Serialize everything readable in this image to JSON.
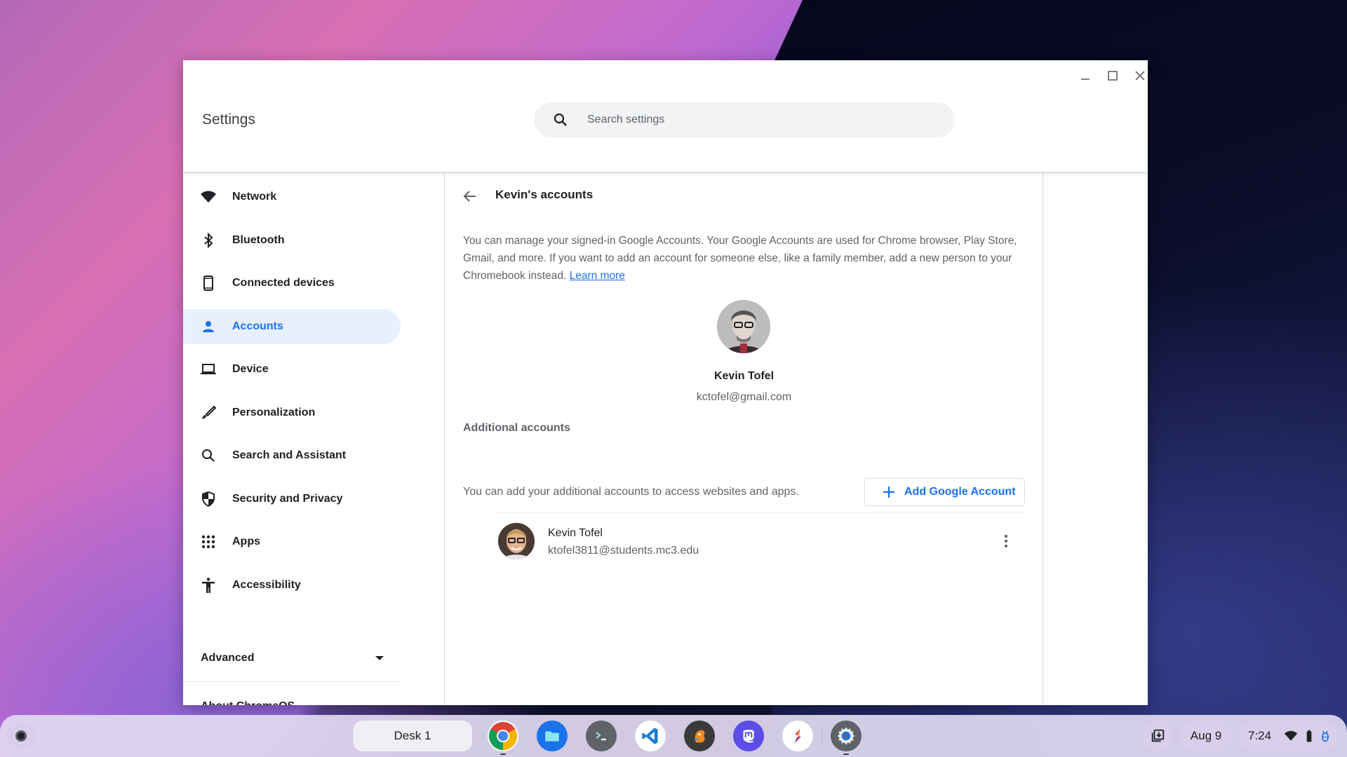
{
  "window": {
    "app_title": "Settings",
    "controls": {
      "minimize": "minimize-icon",
      "maximize": "maximize-icon",
      "close": "close-icon"
    }
  },
  "search": {
    "placeholder": "Search settings",
    "value": "",
    "icon": "search-icon"
  },
  "sidebar": {
    "items": [
      {
        "label": "Network",
        "icon": "wifi-icon",
        "active": false
      },
      {
        "label": "Bluetooth",
        "icon": "bluetooth-icon",
        "active": false
      },
      {
        "label": "Connected devices",
        "icon": "phone-icon",
        "active": false
      },
      {
        "label": "Accounts",
        "icon": "person-icon",
        "active": true
      },
      {
        "label": "Device",
        "icon": "laptop-icon",
        "active": false
      },
      {
        "label": "Personalization",
        "icon": "brush-icon",
        "active": false
      },
      {
        "label": "Search and Assistant",
        "icon": "search-icon",
        "active": false
      },
      {
        "label": "Security and Privacy",
        "icon": "shield-icon",
        "active": false
      },
      {
        "label": "Apps",
        "icon": "apps-grid-icon",
        "active": false
      },
      {
        "label": "Accessibility",
        "icon": "accessibility-icon",
        "active": false
      }
    ],
    "advanced_label": "Advanced",
    "about_label": "About ChromeOS"
  },
  "main": {
    "page_title": "Kevin's accounts",
    "description": "You can manage your signed-in Google Accounts. Your Google Accounts are used for Chrome browser, Play Store, Gmail, and more. If you want to add an account for someone else, like a family member, add a new person to your Chromebook instead.",
    "learn_more": "Learn more",
    "primary_account": {
      "name": "Kevin Tofel",
      "email": "kctofel@gmail.com"
    },
    "additional_heading": "Additional accounts",
    "additional_desc": "You can add your additional accounts to access websites and apps.",
    "add_button": "Add Google Account",
    "accounts": [
      {
        "name": "Kevin Tofel",
        "email": "ktofel3811@students.mc3.edu"
      }
    ]
  },
  "shelf": {
    "desk_label": "Desk 1",
    "apps": [
      {
        "name": "Chrome",
        "icon": "chrome-icon",
        "running": true
      },
      {
        "name": "Files",
        "icon": "files-icon",
        "running": false
      },
      {
        "name": "Terminal",
        "icon": "terminal-icon",
        "running": false
      },
      {
        "name": "Visual Studio Code",
        "icon": "vscode-icon",
        "running": false
      },
      {
        "name": "Squirrel App",
        "icon": "squirrel-app-icon",
        "running": false
      },
      {
        "name": "Mastodon",
        "icon": "mastodon-icon",
        "running": false
      },
      {
        "name": "Squid",
        "icon": "squid-icon",
        "running": false
      },
      {
        "name": "Settings",
        "icon": "settings-gear-icon",
        "running": true
      }
    ],
    "date": "Aug 9",
    "time": "7:24",
    "accent_color": "#1a73e8"
  }
}
